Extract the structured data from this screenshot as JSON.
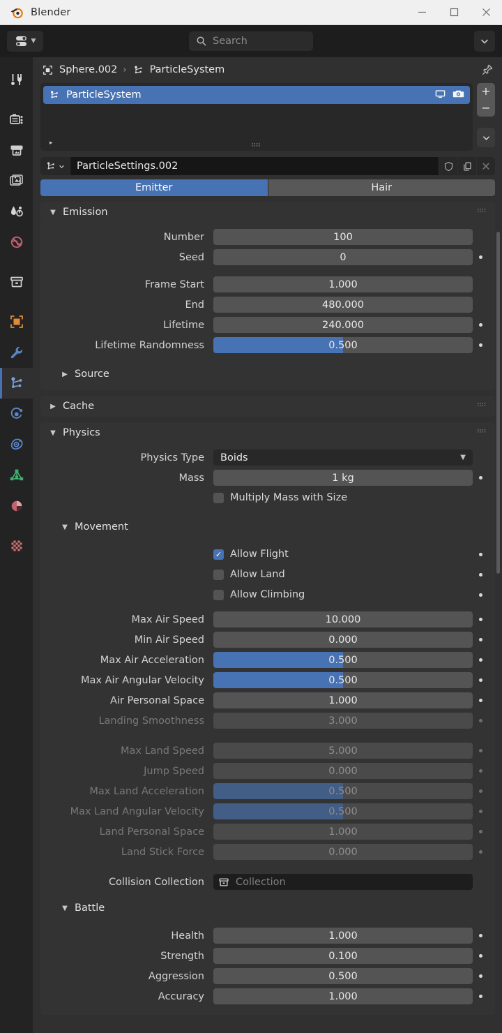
{
  "window": {
    "title": "Blender",
    "minimize_label": "—",
    "maximize_label": "□",
    "close_label": "✕"
  },
  "topbar": {
    "editor_type": "properties-editor",
    "search_placeholder": "Search",
    "search_value": "",
    "overflow_label": "chevron-down"
  },
  "rail": {
    "items": [
      {
        "name": "tool",
        "label": "Tool"
      },
      {
        "name": "render",
        "label": "Render"
      },
      {
        "name": "output",
        "label": "Output"
      },
      {
        "name": "view-layer",
        "label": "View Layer"
      },
      {
        "name": "scene",
        "label": "Scene"
      },
      {
        "name": "world",
        "label": "World"
      },
      {
        "name": "collection",
        "label": "Collection"
      },
      {
        "name": "object",
        "label": "Object"
      },
      {
        "name": "modifiers",
        "label": "Modifiers"
      },
      {
        "name": "particles",
        "label": "Particles"
      },
      {
        "name": "physics",
        "label": "Physics"
      },
      {
        "name": "constraints",
        "label": "Object Constraints"
      },
      {
        "name": "object-data",
        "label": "Object Data"
      },
      {
        "name": "material",
        "label": "Material"
      },
      {
        "name": "texture",
        "label": "Texture"
      }
    ],
    "active": "particles"
  },
  "breadcrumb": {
    "object": "Sphere.002",
    "separator": "›",
    "leaf": "ParticleSystem",
    "pin_label": "pin"
  },
  "particle_list": {
    "rows": [
      {
        "name": "ParticleSystem",
        "selected": true,
        "viewport_icon": "monitor-icon",
        "render_icon": "camera-icon"
      }
    ],
    "add_label": "+",
    "remove_label": "−",
    "specials_label": "chevron-down",
    "expand_label": "▸"
  },
  "datablock": {
    "id_type_label": "particles-id",
    "name": "ParticleSettings.002",
    "fake_user_label": "shield",
    "duplicate_label": "copy",
    "unlink_label": "✕"
  },
  "type_toggle": {
    "options": [
      "Emitter",
      "Hair"
    ],
    "selected": "Emitter"
  },
  "panels": {
    "emission": {
      "title": "Emission",
      "open": true,
      "rows": [
        {
          "label": "Number",
          "value": "100",
          "slider": 0,
          "decorator": false,
          "dim": false
        },
        {
          "label": "Seed",
          "value": "0",
          "slider": 0,
          "decorator": true,
          "dim": false
        },
        {
          "label": "Frame Start",
          "value": "1.000",
          "slider": 0,
          "decorator": false,
          "dim": false
        },
        {
          "label": "End",
          "value": "480.000",
          "slider": 0,
          "decorator": false,
          "dim": false
        },
        {
          "label": "Lifetime",
          "value": "240.000",
          "slider": 0,
          "decorator": true,
          "dim": false
        },
        {
          "label": "Lifetime Randomness",
          "value": "0.500",
          "slider": 50,
          "decorator": true,
          "dim": false
        }
      ],
      "subpanels": [
        {
          "title": "Source",
          "open": false
        }
      ]
    },
    "cache": {
      "title": "Cache",
      "open": false
    },
    "physics": {
      "title": "Physics",
      "open": true,
      "physics_type": {
        "label": "Physics Type",
        "value": "Boids"
      },
      "mass": {
        "label": "Mass",
        "value": "1 kg",
        "decorator": true
      },
      "multiply_mass": {
        "label": "Multiply Mass with Size",
        "checked": false
      },
      "movement": {
        "title": "Movement",
        "open": true,
        "checkboxes": [
          {
            "label": "Allow Flight",
            "checked": true,
            "decorator": true
          },
          {
            "label": "Allow Land",
            "checked": false,
            "decorator": true
          },
          {
            "label": "Allow Climbing",
            "checked": false,
            "decorator": true
          }
        ],
        "air_rows": [
          {
            "label": "Max Air Speed",
            "value": "10.000",
            "slider": 0,
            "decorator": true,
            "dim": false
          },
          {
            "label": "Min Air Speed",
            "value": "0.000",
            "slider": 0,
            "decorator": true,
            "dim": false
          },
          {
            "label": "Max Air Acceleration",
            "value": "0.500",
            "slider": 50,
            "decorator": true,
            "dim": false
          },
          {
            "label": "Max Air Angular Velocity",
            "value": "0.500",
            "slider": 50,
            "decorator": true,
            "dim": false
          },
          {
            "label": "Air Personal Space",
            "value": "1.000",
            "slider": 0,
            "decorator": true,
            "dim": false
          },
          {
            "label": "Landing Smoothness",
            "value": "3.000",
            "slider": 0,
            "decorator": true,
            "dim": true
          }
        ],
        "land_rows": [
          {
            "label": "Max Land Speed",
            "value": "5.000",
            "slider": 0,
            "decorator": true,
            "dim": true
          },
          {
            "label": "Jump Speed",
            "value": "0.000",
            "slider": 0,
            "decorator": true,
            "dim": true
          },
          {
            "label": "Max Land Acceleration",
            "value": "0.500",
            "slider": 50,
            "decorator": true,
            "dim": true
          },
          {
            "label": "Max Land Angular Velocity",
            "value": "0.500",
            "slider": 50,
            "decorator": true,
            "dim": true
          },
          {
            "label": "Land Personal Space",
            "value": "1.000",
            "slider": 0,
            "decorator": true,
            "dim": true
          },
          {
            "label": "Land Stick Force",
            "value": "0.000",
            "slider": 0,
            "decorator": true,
            "dim": true
          }
        ],
        "collision_collection": {
          "label": "Collision Collection",
          "placeholder": "Collection",
          "value": ""
        }
      },
      "battle": {
        "title": "Battle",
        "open": true,
        "rows": [
          {
            "label": "Health",
            "value": "1.000",
            "slider": 0,
            "decorator": true,
            "dim": false
          },
          {
            "label": "Strength",
            "value": "0.100",
            "slider": 0,
            "decorator": true,
            "dim": false
          },
          {
            "label": "Aggression",
            "value": "0.500",
            "slider": 0,
            "decorator": true,
            "dim": false
          },
          {
            "label": "Accuracy",
            "value": "1.000",
            "slider": 0,
            "decorator": true,
            "dim": false
          }
        ]
      }
    }
  },
  "colors": {
    "accent_blue": "#4772b3",
    "panel_bg": "#333333",
    "editor_bg": "#303030",
    "field_bg": "#545454",
    "rail_bg": "#232323",
    "window_bg": "#1d1d1d"
  }
}
